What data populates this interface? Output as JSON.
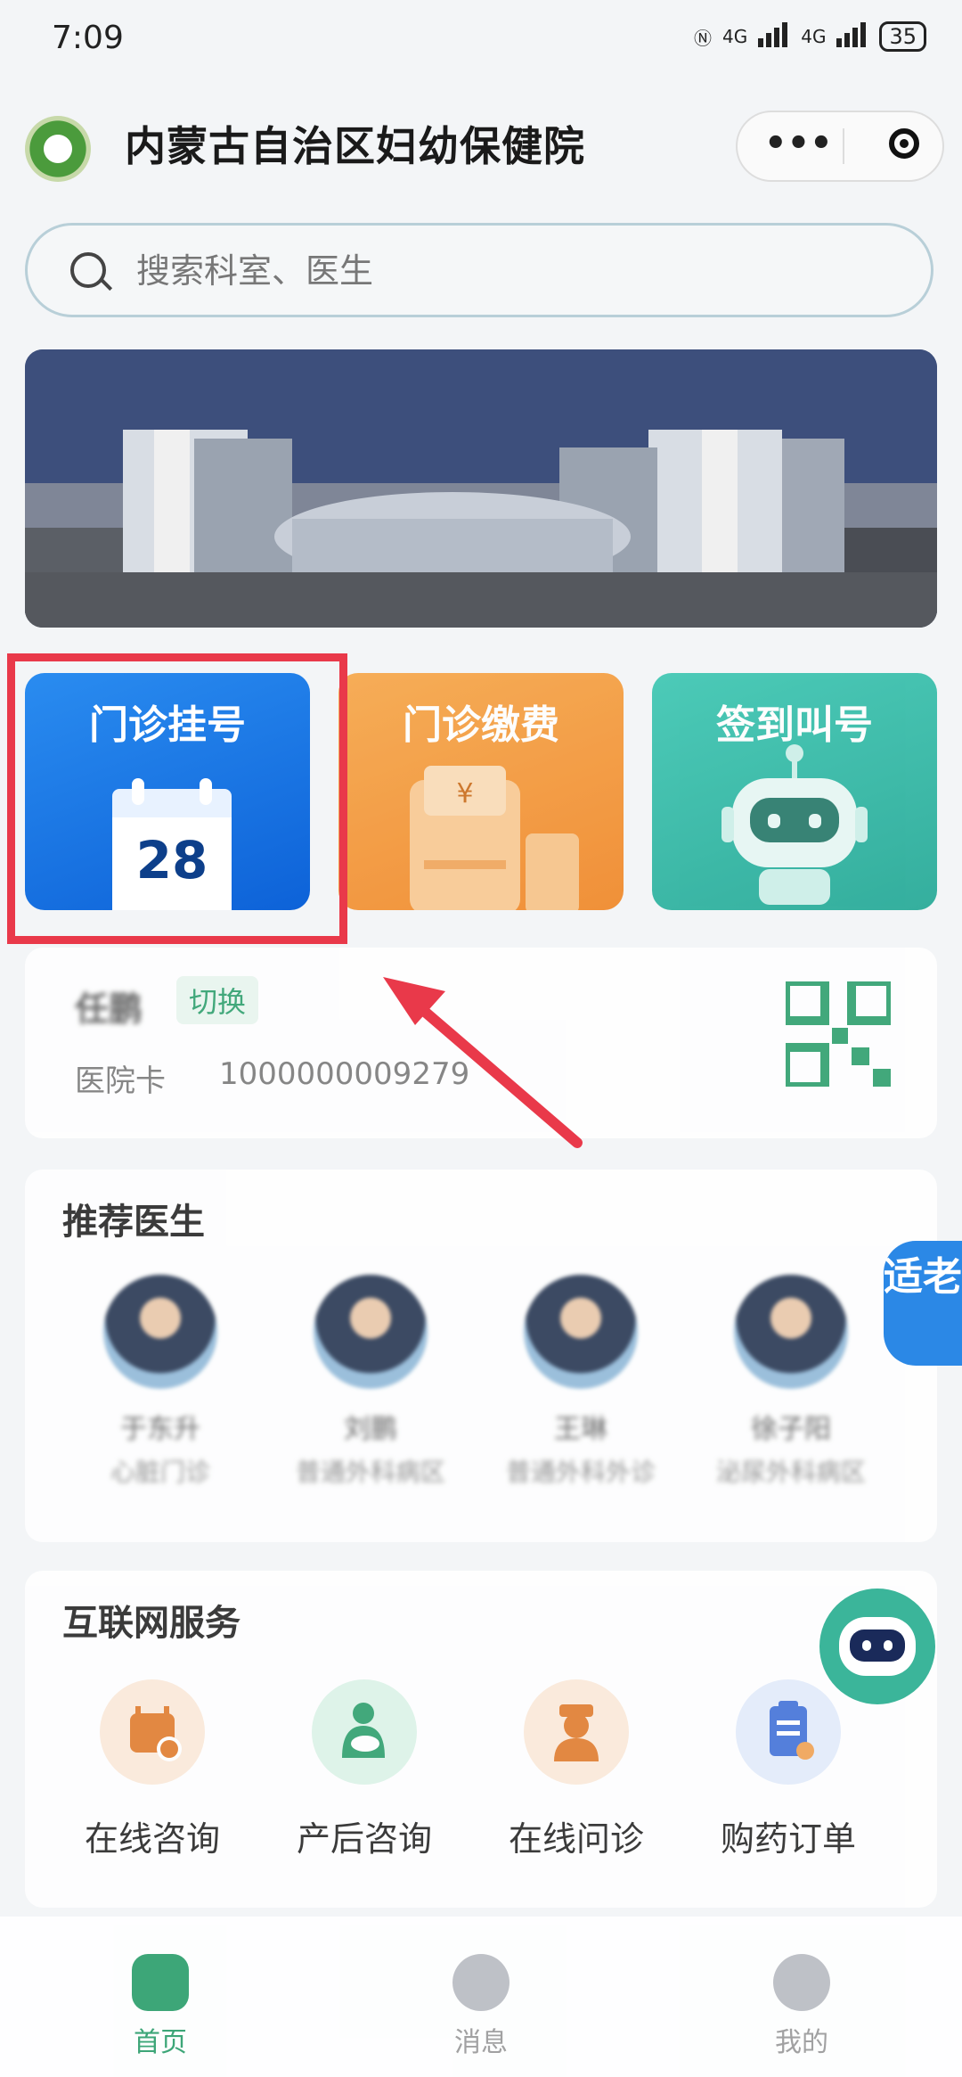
{
  "status_bar": {
    "time": "7:09",
    "network1": "4G",
    "network2": "4G",
    "battery": "35"
  },
  "header": {
    "title": "内蒙古自治区妇幼保健院",
    "more_glyph": "•••"
  },
  "search": {
    "placeholder": "搜索科室、医生"
  },
  "tiles": [
    {
      "label": "门诊挂号",
      "calendar_day": "28"
    },
    {
      "label": "门诊缴费",
      "yen": "¥"
    },
    {
      "label": "签到叫号"
    }
  ],
  "patient": {
    "name": "任鹏",
    "switch_label": "切换",
    "card_label": "医院卡",
    "card_number": "1000000009279"
  },
  "doctors_section": {
    "title": "推荐医生",
    "doctors": [
      {
        "name": "于东升",
        "dept": "心脏门诊"
      },
      {
        "name": "刘鹏",
        "dept": "普通外科病区"
      },
      {
        "name": "王琳",
        "dept": "普通外科外诊"
      },
      {
        "name": "徐子阳",
        "dept": "泌尿外科病区"
      }
    ],
    "side_tab_label": "适老"
  },
  "services_section": {
    "title": "互联网服务",
    "items": [
      {
        "label": "在线咨询",
        "icon": "calendar-plus-icon",
        "color": "#e07a2a",
        "bg": "#fbe9d9"
      },
      {
        "label": "产后咨询",
        "icon": "mother-baby-icon",
        "color": "#2a9e6b",
        "bg": "#dcf3e8"
      },
      {
        "label": "在线问诊",
        "icon": "nurse-icon",
        "color": "#e07a2a",
        "bg": "#fbe9d9"
      },
      {
        "label": "购药订单",
        "icon": "clipboard-icon",
        "color": "#3f6fd8",
        "bg": "#e2ebfb"
      }
    ]
  },
  "tabbar": [
    {
      "label": "首页",
      "active": true
    },
    {
      "label": "消息",
      "active": false
    },
    {
      "label": "我的",
      "active": false
    }
  ],
  "colors": {
    "accent": "#2a9e6b",
    "highlight": "#e9394a",
    "primary_blue": "#1e7ee6"
  }
}
